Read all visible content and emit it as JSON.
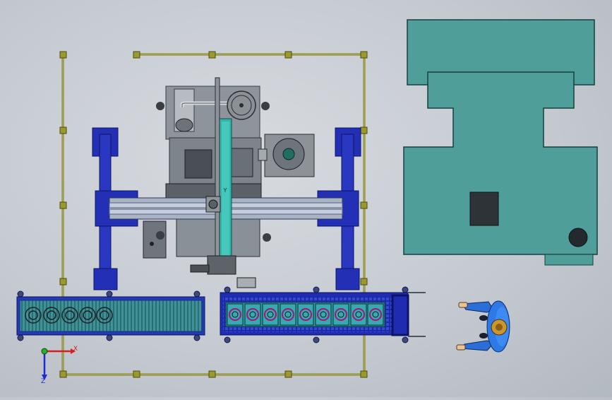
{
  "view": {
    "background_color": "#c8cdd3",
    "triad": {
      "x_label": "X",
      "y_label": "Y",
      "z_label": "Z"
    }
  },
  "machine": {
    "gantry_axis_label": "Y"
  },
  "colors": {
    "frame_blue": "#1f2bb0",
    "frame_blue_dark": "#10197a",
    "rail_steel": "#9aa7bd",
    "teal": "#4e9f9a",
    "teal_bright": "#2fb0a6",
    "olive_fence": "#8c8a2a",
    "conveyor_roller": "#3c8f92",
    "part_magenta": "#a0167a",
    "machine_grey": "#7f858c",
    "machine_dark": "#4a4f55"
  },
  "icons": [
    "coordinate-triad-icon",
    "operator-figure-icon"
  ]
}
